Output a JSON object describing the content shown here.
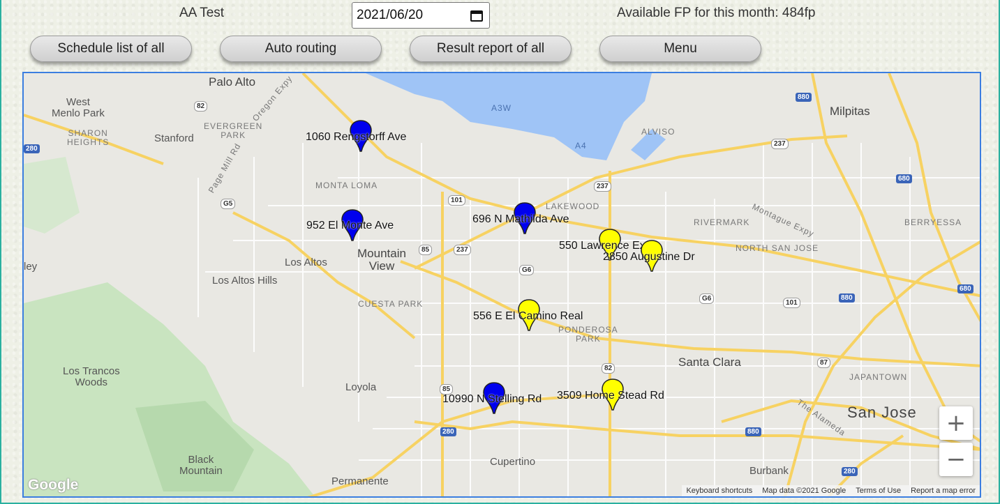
{
  "header": {
    "user_name": "AA Test",
    "date_value": "2021/06/20",
    "fp_text": "Available FP for this month: 484fp"
  },
  "toolbar": {
    "schedule_label": "Schedule list of all",
    "auto_label": "Auto routing",
    "result_label": "Result report of all",
    "menu_label": "Menu"
  },
  "map": {
    "places": {
      "palo_alto": "Palo Alto",
      "west_menlo_park": "West\nMenlo Park",
      "sharon_heights": "SHARON\nHEIGHTS",
      "stanford": "Stanford",
      "evergreen_park": "EVERGREEN\nPARK",
      "monta_loma": "MONTA LOMA",
      "mountain_view": "Mountain\nView",
      "los_altos": "Los Altos",
      "los_altos_hills": "Los Altos Hills",
      "cuesta_park": "CUESTA PARK",
      "lakewood": "LAKEWOOD",
      "rivermark": "RIVERMARK",
      "north_san_jose": "NORTH SAN JOSE",
      "berryessa": "BERRYESSA",
      "milpitas": "Milpitas",
      "alviso": "ALVISO",
      "ponderosa_park": "PONDEROSA\nPARK",
      "santa_clara": "Santa Clara",
      "japantown": "JAPANTOWN",
      "san_jose": "San Jose",
      "los_trancos_woods": "Los Trancos\nWoods",
      "loyola": "Loyola",
      "black_mountain": "Black\nMountain",
      "cupertino": "Cupertino",
      "permanente": "Permanente",
      "burbank": "Burbank",
      "the_alameda": "The Alameda",
      "montague_expy": "Montague Expy",
      "oregon_expy": "Oregon Expy",
      "page_mill_rd": "Page Mill Rd",
      "ley": "ley"
    },
    "shields": [
      "82",
      "101",
      "237",
      "G5",
      "85",
      "237",
      "G6",
      "G6",
      "101",
      "82",
      "87",
      "85",
      "280",
      "880",
      "880",
      "680",
      "680",
      "880",
      "280",
      "280",
      "237",
      "A3W",
      "A4"
    ],
    "pins": [
      {
        "label": "1060 Rengstorff Ave",
        "color": "#0000ee"
      },
      {
        "label": "952 El Monte Ave",
        "color": "#0000ee"
      },
      {
        "label": "696 N Mathilda Ave",
        "color": "#0000ee"
      },
      {
        "label": "550 Lawrence Expy",
        "color": "#ffff00"
      },
      {
        "label": "2850 Augustine Dr",
        "color": "#ffff00"
      },
      {
        "label": "556 E El Camino Real",
        "color": "#ffff00"
      },
      {
        "label": "10990 N Stelling Rd",
        "color": "#0000ee"
      },
      {
        "label": "3509 Home Stead Rd",
        "color": "#ffff00"
      }
    ],
    "zoom_in": "+",
    "zoom_out": "−",
    "google_logo": "Google",
    "footer": {
      "shortcuts": "Keyboard shortcuts",
      "map_data": "Map data ©2021 Google",
      "terms": "Terms of Use",
      "report": "Report a map error"
    }
  }
}
